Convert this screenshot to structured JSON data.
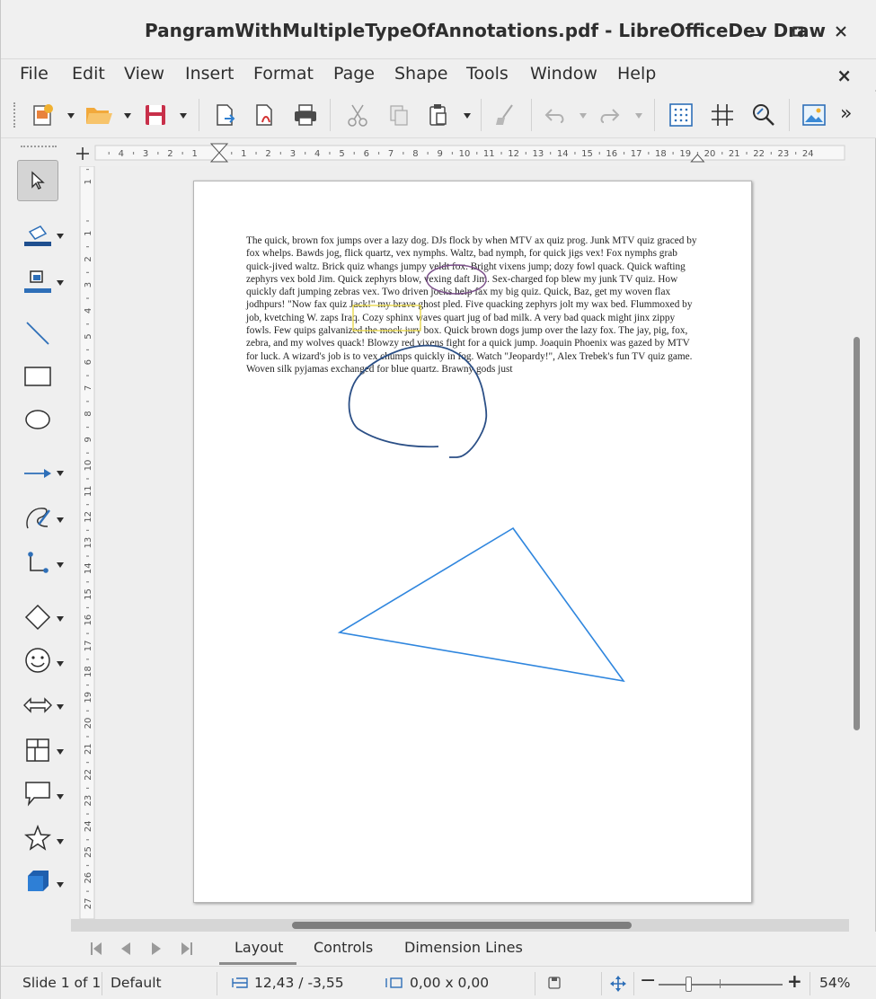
{
  "window": {
    "title": "PangramWithMultipleTypeOfAnnotations.pdf - LibreOfficeDev Draw"
  },
  "menu": {
    "items": [
      "File",
      "Edit",
      "View",
      "Insert",
      "Format",
      "Page",
      "Shape",
      "Tools",
      "Window",
      "Help"
    ],
    "close_glyph": "×"
  },
  "toolbar": {
    "overflow_glyph": "»"
  },
  "ruler": {
    "ticks": [
      "4",
      "3",
      "2",
      "1",
      "1",
      "2",
      "3",
      "4",
      "5",
      "6",
      "7",
      "8",
      "9",
      "10",
      "11",
      "12",
      "13",
      "14",
      "15",
      "16",
      "17",
      "18",
      "19",
      "20",
      "21",
      "22",
      "23",
      "24"
    ],
    "vticks": [
      "1",
      "1",
      "2",
      "3",
      "4",
      "5",
      "6",
      "7",
      "8",
      "9",
      "10",
      "11",
      "12",
      "13",
      "14",
      "15",
      "16",
      "17",
      "18",
      "19",
      "20",
      "21",
      "22",
      "23",
      "24",
      "25",
      "26",
      "27"
    ]
  },
  "document": {
    "text": "The quick, brown fox jumps over a lazy dog. DJs flock by when MTV ax quiz prog. Junk MTV quiz graced by fox whelps. Bawds jog, flick quartz, vex nymphs. Waltz, bad nymph, for quick jigs vex! Fox nymphs grab quick-jived waltz. Brick quiz whangs jumpy veldt fox. Bright vixens jump; dozy fowl quack. Quick wafting zephyrs vex bold Jim. Quick zephyrs blow, vexing daft Jim. Sex-charged fop blew my junk TV quiz. How quickly daft jumping zebras vex. Two driven jocks help fax my big quiz. Quick, Baz, get my woven flax jodhpurs! \"Now fax quiz Jack!\" my brave ghost pled. Five quacking zephyrs jolt my wax bed. Flummoxed by job, kvetching W. zaps Iraq. Cozy sphinx waves quart jug of bad milk. A very bad quack might jinx zippy fowls. Few quips galvanized the mock jury box. Quick brown dogs jump over the lazy fox. The jay, pig, fox, zebra, and my wolves quack! Blowzy red vixens fight for a quick jump. Joaquin Phoenix was gazed by MTV for luck. A wizard's job is to vex chumps quickly in fog. Watch \"Jeopardy!\", Alex Trebek's fun TV quiz game. Woven silk pyjamas exchanged for blue quartz. Brawny gods just",
    "annotation_colors": {
      "ellipse": "#7b4f8a",
      "highlight_box": "#e8d640",
      "ink": "#2b4f86",
      "triangle": "#2f86de"
    }
  },
  "tabs": [
    "Layout",
    "Controls",
    "Dimension Lines"
  ],
  "status": {
    "slide": "Slide 1 of 1",
    "master": "Default",
    "position": "12,43 / -3,55",
    "size": "0,00 x 0,00",
    "zoom": "54%",
    "zoom_minus": "−",
    "zoom_plus": "+"
  }
}
